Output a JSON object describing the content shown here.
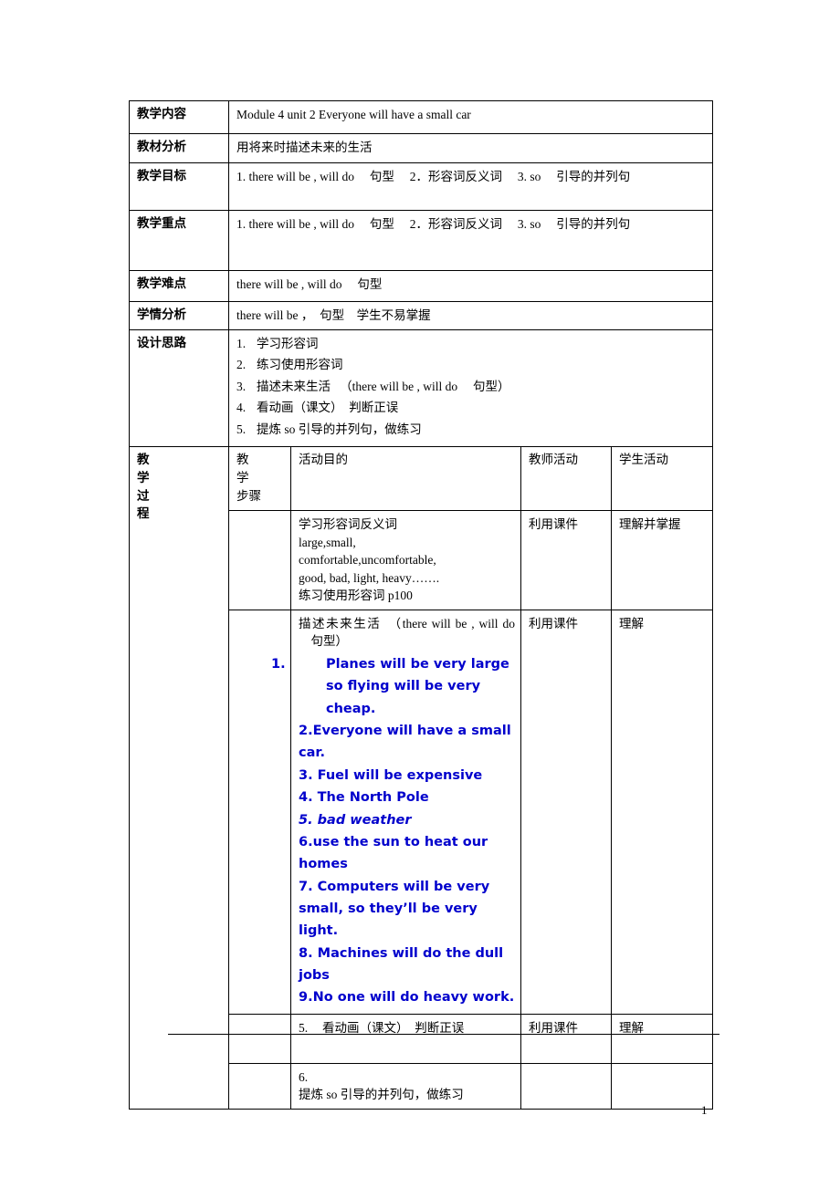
{
  "document": {
    "page_number": "1",
    "blue_color": "#0000cc"
  },
  "rows": {
    "content": {
      "label": "教学内容",
      "value": "Module 4 unit 2 Everyone will have a small car"
    },
    "material_analysis": {
      "label": "教材分析",
      "value": "用将来时描述未来的生活"
    },
    "objectives": {
      "label": "教学目标",
      "value": "1. there will be , will do 　句型　 2．形容词反义词 　3. so 　引导的并列句"
    },
    "key_points": {
      "label": "教学重点",
      "value": "1. there will be , will do 　句型　 2．形容词反义词 　3. so 　引导的并列句"
    },
    "difficult_points": {
      "label": "教学难点",
      "value": " there will be , will do 　句型"
    },
    "student_analysis": {
      "label": "学情分析",
      "value": "there will be ，　句型　学生不易掌握"
    },
    "design": {
      "label": "设计思路",
      "items": [
        {
          "num": "1.",
          "text": "学习形容词"
        },
        {
          "num": "2.",
          "text": "练习使用形容词"
        },
        {
          "num": "3.",
          "text": "描述未来生活 　（there will be , will do 　句型）"
        },
        {
          "num": "4.",
          "text": "看动画（课文）　判断正误"
        },
        {
          "num": "5.",
          "text": "提炼 so  引导的并列句，做练习"
        }
      ]
    }
  },
  "process": {
    "label_chars": [
      "教",
      "学",
      "过",
      "程"
    ],
    "headers": {
      "steps_line1": "教　学",
      "steps_line2": "步骤",
      "purpose": "活动目的",
      "teacher": "教师活动",
      "student": "学生活动"
    },
    "activities": [
      {
        "steps": "",
        "purpose_lines": [
          "学习形容词反义词",
          "large,small,",
          "comfortable,uncomfortable,",
          "good, bad, light, heavy…….",
          "练习使用形容词  p100"
        ],
        "teacher": "利用课件",
        "student": "理解并掌握"
      },
      {
        "steps": "",
        "purpose_intro": "描述未来生活　（there will be , will do 　句型）",
        "blue_items": [
          {
            "num": "1.",
            "text": "Planes will be very large so flying will be very cheap.",
            "hanging": true,
            "italic": false
          },
          {
            "num": "2.",
            "text": "Everyone will have a small car.",
            "hanging": false,
            "italic": false
          },
          {
            "num": "3.",
            "text": " Fuel will be expensive",
            "hanging": false,
            "italic": false
          },
          {
            "num": "4.",
            "text": " The North Pole",
            "hanging": false,
            "italic": false
          },
          {
            "num": "5.",
            "text": " bad weather",
            "hanging": false,
            "italic": true
          },
          {
            "num": "6.",
            "text": "use the sun to heat our homes",
            "hanging": false,
            "italic": false
          },
          {
            "num": "7.",
            "text": " Computers will be very small, so they’ll be very light.",
            "hanging": false,
            "italic": false
          },
          {
            "num": "8.",
            "text": " Machines will do the dull jobs",
            "hanging": false,
            "italic": false
          },
          {
            "num": "9.",
            "text": "No one will do heavy work.",
            "hanging": false,
            "italic": false
          }
        ],
        "teacher": "利用课件",
        "student": "理解"
      },
      {
        "steps": "",
        "purpose_num": "5.",
        "purpose_text": "看动画（课文）　判断正误",
        "teacher": "利用课件",
        "student": "理解"
      },
      {
        "steps": "",
        "purpose_num": "6.",
        "purpose_text": "提炼 so  引导的并列句，做练习",
        "teacher": "",
        "student": ""
      }
    ]
  }
}
